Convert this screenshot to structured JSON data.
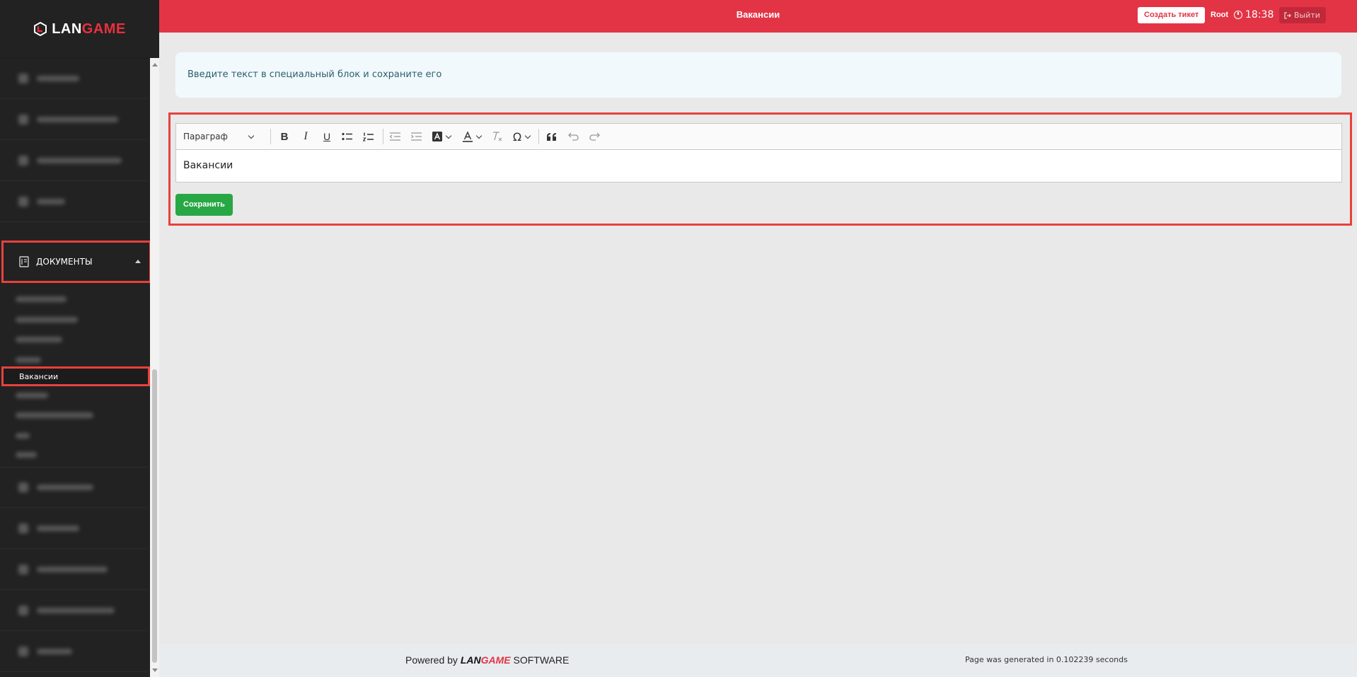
{
  "brand": {
    "logo_part1": "LAN",
    "logo_part2": "GAME",
    "accent_color": "#e33446",
    "logo_icon": "langame-logo-icon"
  },
  "header": {
    "page_title": "Вакансии",
    "create_ticket_label": "Создать тикет",
    "user_name": "Root",
    "clock_icon": "clock-icon",
    "time": "18:38",
    "logout_icon": "logout-icon",
    "logout_label": "Выйти"
  },
  "sidebar": {
    "documents_section": {
      "label": "ДОКУМЕНТЫ",
      "icon": "document-icon",
      "expanded": true,
      "active_item": "Вакансии"
    }
  },
  "main": {
    "info_message": "Введите текст в специальный блок и сохраните его",
    "editor": {
      "paragraph_select": "Параграф",
      "toolbar_icons": [
        "bold-icon",
        "italic-icon",
        "underline-icon",
        "bulleted-list-icon",
        "numbered-list-icon",
        "outdent-icon",
        "indent-icon",
        "highlight-icon",
        "font-color-icon",
        "remove-format-icon",
        "special-characters-icon",
        "block-quote-icon",
        "undo-icon",
        "redo-icon"
      ],
      "bold": "B",
      "italic": "I",
      "underline": "U",
      "special_chars": "Ω",
      "content": "Вакансии"
    },
    "save_label": "Сохранить"
  },
  "footer": {
    "powered_prefix": "Powered by",
    "powered_brand_a": "LAN",
    "powered_brand_b": "GAME",
    "powered_suffix": "SOFTWARE",
    "generated": "Page was generated in 0.102239 seconds"
  }
}
